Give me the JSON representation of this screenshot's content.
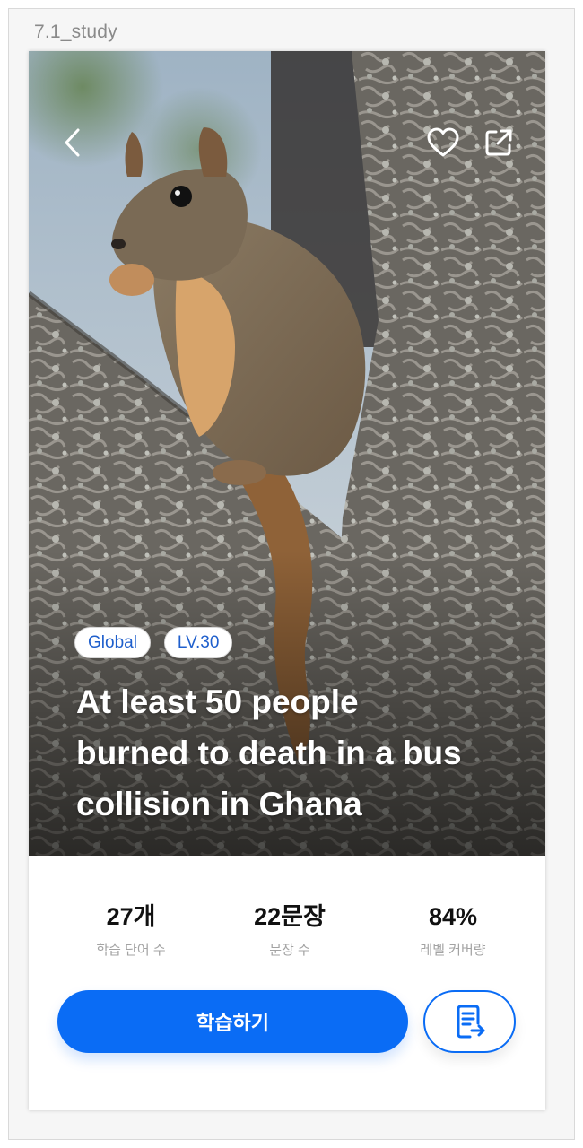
{
  "frame": {
    "title": "7.1_study"
  },
  "hero": {
    "image_subject": "squirrel on tree",
    "back_icon": "chevron-left-icon",
    "like_icon": "heart-icon",
    "share_icon": "external-link-icon",
    "tags": [
      "Global",
      "LV.30"
    ],
    "headline_lines": [
      "At least 50 people",
      "burned to death in a bus",
      "collision in Ghana"
    ]
  },
  "stats": [
    {
      "value": "27개",
      "label": "학습 단어 수"
    },
    {
      "value": "22문장",
      "label": "문장 수"
    },
    {
      "value": "84%",
      "label": "레벨 커버량"
    }
  ],
  "actions": {
    "study_label": "학습하기",
    "doc_icon": "document-list-icon"
  },
  "colors": {
    "accent": "#0a6cf5",
    "tag_text": "#1f5fcc"
  }
}
